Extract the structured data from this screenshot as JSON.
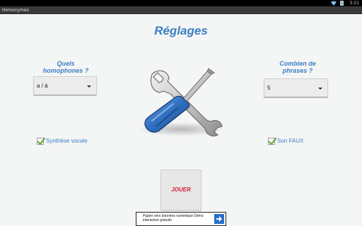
{
  "status_bar": {
    "clock": "3:21",
    "icons": [
      "wifi-icon",
      "battery-icon"
    ]
  },
  "app": {
    "title": "Homonymes"
  },
  "page": {
    "title": "Réglages"
  },
  "settings": {
    "homophones": {
      "question": "Quels homophones ?",
      "selected": "a / à"
    },
    "phrases": {
      "question": "Combien de phrases ?",
      "selected": "5"
    },
    "synthese_vocale": {
      "label": "Synthèse vocale",
      "checked": true
    },
    "son_faux": {
      "label": "Son FAUX",
      "checked": true
    }
  },
  "play_button": {
    "label": "JOUER"
  },
  "ad": {
    "text": "Papier vers données numérique Démo interactive gratuite",
    "icon": "arrow-right-icon"
  },
  "colors": {
    "accent": "#3a7fc4",
    "play": "#d0223c",
    "check": "#6aa83a"
  }
}
